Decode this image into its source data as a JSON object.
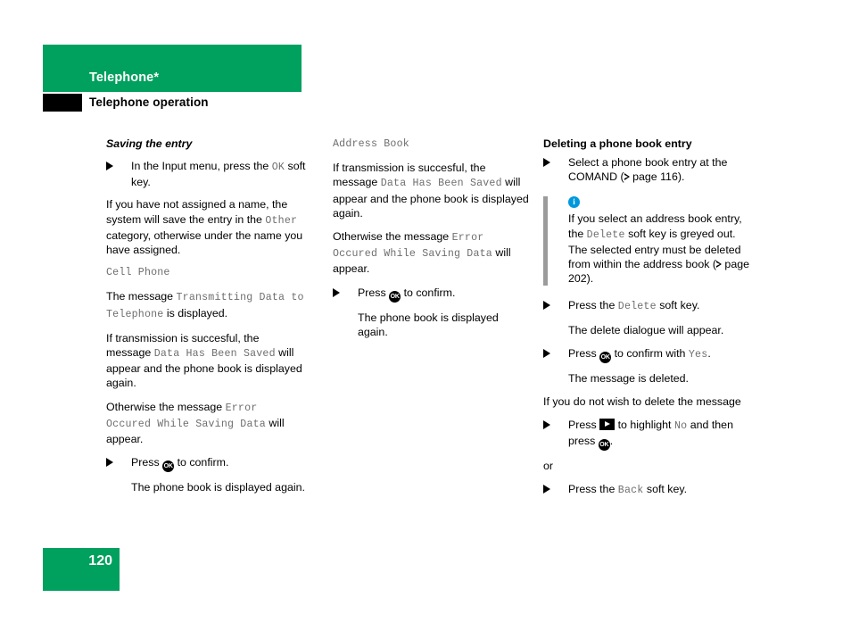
{
  "header": {
    "chapter_title": "Telephone*",
    "section_title": "Telephone operation"
  },
  "footer": {
    "page_number": "120"
  },
  "columns": [
    {
      "id": "column-left",
      "heading": "Saving the entry",
      "blocks": [
        {
          "type": "step",
          "parts": [
            {
              "t": "plain",
              "v": "In the Input menu, press the "
            },
            {
              "t": "mono",
              "v": "OK"
            },
            {
              "t": "plain",
              "v": " soft key."
            }
          ]
        },
        {
          "type": "para",
          "parts": [
            {
              "t": "plain",
              "v": "If you have not assigned a name, the system will save the entry in the "
            },
            {
              "t": "mono",
              "v": "Other"
            },
            {
              "t": "plain",
              "v": " category, otherwise under the name you have assigned."
            }
          ]
        },
        {
          "type": "mono-line",
          "parts": [
            {
              "t": "mono",
              "v": "Cell Phone"
            }
          ]
        },
        {
          "type": "para",
          "parts": [
            {
              "t": "plain",
              "v": "The message "
            },
            {
              "t": "mono",
              "v": "Transmitting Data to Telephone"
            },
            {
              "t": "plain",
              "v": " is displayed."
            }
          ]
        },
        {
          "type": "para",
          "parts": [
            {
              "t": "plain",
              "v": "If transmission is succesful, the message "
            },
            {
              "t": "mono",
              "v": "Data Has Been Saved"
            },
            {
              "t": "plain",
              "v": " will appear and the phone book is displayed again."
            }
          ]
        },
        {
          "type": "para",
          "parts": [
            {
              "t": "plain",
              "v": "Otherwise the message "
            },
            {
              "t": "mono",
              "v": "Error Occured While Saving Data"
            },
            {
              "t": "plain",
              "v": " will appear."
            }
          ]
        },
        {
          "type": "step",
          "parts": [
            {
              "t": "plain",
              "v": "Press "
            },
            {
              "t": "okkey",
              "v": "OK"
            },
            {
              "t": "plain",
              "v": " to confirm."
            }
          ]
        },
        {
          "type": "step-note",
          "parts": [
            {
              "t": "plain",
              "v": "The phone book is displayed again."
            }
          ]
        }
      ]
    },
    {
      "id": "column-middle",
      "heading": "",
      "blocks": [
        {
          "type": "mono-line",
          "parts": [
            {
              "t": "mono",
              "v": "Address Book"
            }
          ]
        },
        {
          "type": "para",
          "parts": [
            {
              "t": "plain",
              "v": "If transmission is succesful, the message "
            },
            {
              "t": "mono",
              "v": "Data Has Been Saved"
            },
            {
              "t": "plain",
              "v": " will appear and the phone book is displayed again."
            }
          ]
        },
        {
          "type": "para",
          "parts": [
            {
              "t": "plain",
              "v": "Otherwise the message "
            },
            {
              "t": "mono",
              "v": "Error Occured While Saving Data"
            },
            {
              "t": "plain",
              "v": " will appear."
            }
          ]
        },
        {
          "type": "step",
          "parts": [
            {
              "t": "plain",
              "v": "Press "
            },
            {
              "t": "okkey",
              "v": "OK"
            },
            {
              "t": "plain",
              "v": " to confirm."
            }
          ]
        },
        {
          "type": "step-note",
          "parts": [
            {
              "t": "plain",
              "v": "The phone book is displayed again."
            }
          ]
        }
      ]
    },
    {
      "id": "column-right",
      "heading": "Deleting a phone book entry",
      "blocks": [
        {
          "type": "step",
          "parts": [
            {
              "t": "plain",
              "v": "Select a phone book entry at the COMAND ("
            },
            {
              "t": "reftri",
              "v": ""
            },
            {
              "t": "plain",
              "v": " page 116)."
            }
          ]
        },
        {
          "type": "note",
          "parts": [
            {
              "t": "plain",
              "v": "If you select an address book entry, the "
            },
            {
              "t": "mono",
              "v": "Delete"
            },
            {
              "t": "plain",
              "v": " soft key is greyed out. The selected entry must be deleted from within the address book ("
            },
            {
              "t": "reftri",
              "v": ""
            },
            {
              "t": "plain",
              "v": " page 202)."
            }
          ]
        },
        {
          "type": "step",
          "parts": [
            {
              "t": "plain",
              "v": "Press the "
            },
            {
              "t": "mono",
              "v": "Delete"
            },
            {
              "t": "plain",
              "v": " soft key."
            }
          ]
        },
        {
          "type": "step-note",
          "parts": [
            {
              "t": "plain",
              "v": "The delete dialogue will appear."
            }
          ]
        },
        {
          "type": "step",
          "parts": [
            {
              "t": "plain",
              "v": "Press "
            },
            {
              "t": "okkey",
              "v": "OK"
            },
            {
              "t": "plain",
              "v": " to confirm with "
            },
            {
              "t": "mono",
              "v": "Yes"
            },
            {
              "t": "plain",
              "v": "."
            }
          ]
        },
        {
          "type": "step-note",
          "parts": [
            {
              "t": "plain",
              "v": "The message is deleted."
            }
          ]
        },
        {
          "type": "para",
          "parts": [
            {
              "t": "plain",
              "v": "If you do not wish to delete the message"
            }
          ]
        },
        {
          "type": "step",
          "parts": [
            {
              "t": "plain",
              "v": "Press "
            },
            {
              "t": "arrowkey",
              "v": ""
            },
            {
              "t": "plain",
              "v": " to highlight "
            },
            {
              "t": "mono",
              "v": "No"
            },
            {
              "t": "plain",
              "v": " and then press "
            },
            {
              "t": "okkey",
              "v": "OK"
            },
            {
              "t": "plain",
              "v": "."
            }
          ]
        },
        {
          "type": "or",
          "parts": [
            {
              "t": "plain",
              "v": "or"
            }
          ]
        },
        {
          "type": "step",
          "parts": [
            {
              "t": "plain",
              "v": "Press the "
            },
            {
              "t": "mono",
              "v": "Back"
            },
            {
              "t": "plain",
              "v": " soft key."
            }
          ]
        }
      ]
    }
  ],
  "colors": {
    "brand_green": "#00a05e",
    "info_blue": "#0098dc",
    "mono_grey": "#6e6e6e",
    "note_rule_grey": "#9b9b9b"
  }
}
